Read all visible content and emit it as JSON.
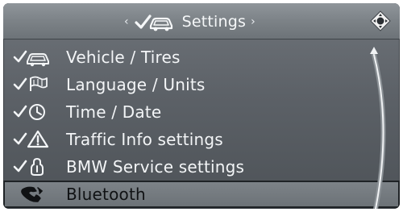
{
  "header": {
    "title": "Settings",
    "left_chevron": "‹",
    "right_chevron": "›"
  },
  "menu": {
    "items": [
      {
        "label": "Vehicle / Tires",
        "icon": "vehicle-tires-icon"
      },
      {
        "label": "Language / Units",
        "icon": "language-units-icon"
      },
      {
        "label": "Time / Date",
        "icon": "time-date-icon"
      },
      {
        "label": "Traffic Info settings",
        "icon": "traffic-info-icon"
      },
      {
        "label": "BMW Service settings",
        "icon": "bmw-service-icon"
      },
      {
        "label": "Bluetooth",
        "icon": "bluetooth-phone-icon",
        "selected": true
      }
    ]
  },
  "colors": {
    "screen": "#5c6167",
    "header": "#7c8287",
    "text": "#f3f5f7",
    "selected_text": "#101214"
  }
}
